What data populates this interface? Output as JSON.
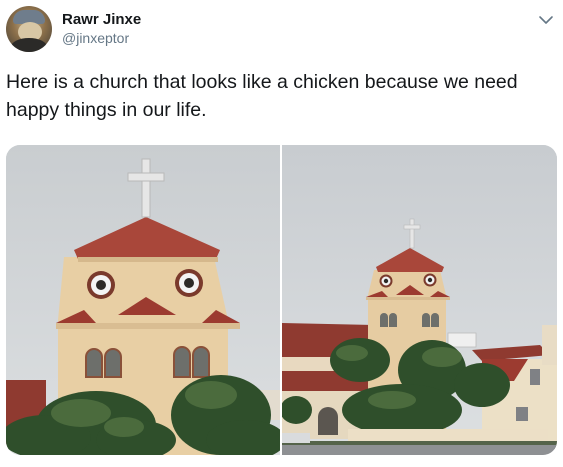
{
  "tweet": {
    "author_name": "Rawr Jinxe",
    "author_handle": "@jinxeptor",
    "text": "Here is a church that looks like a chicken because we need happy things in our life."
  },
  "media": {
    "count": 2
  },
  "icons": {
    "menu": "chevron-down-icon"
  },
  "colors": {
    "text_primary": "#14171a",
    "text_secondary": "#657786",
    "roof": "#9c3b30",
    "wall": "#e8cfa4",
    "sky": "#d4d8db"
  }
}
